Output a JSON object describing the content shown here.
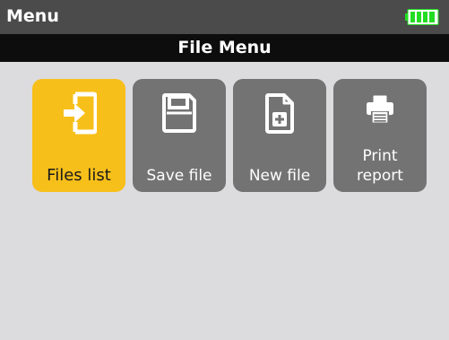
{
  "status_bar": {
    "title": "Menu",
    "battery_icon": "battery-full-icon",
    "battery_color": "#22dd22"
  },
  "header": {
    "title": "File Menu"
  },
  "colors": {
    "selected_tile": "#f7bf1a",
    "tile": "#737373",
    "background": "#dcdbde"
  },
  "tiles": [
    {
      "label": "Files list",
      "icon": "file-import-icon",
      "selected": true
    },
    {
      "label": "Save file",
      "icon": "floppy-disk-icon",
      "selected": false
    },
    {
      "label": "New file",
      "icon": "new-document-icon",
      "selected": false
    },
    {
      "label": "Print report",
      "icon": "printer-icon",
      "selected": false
    }
  ]
}
